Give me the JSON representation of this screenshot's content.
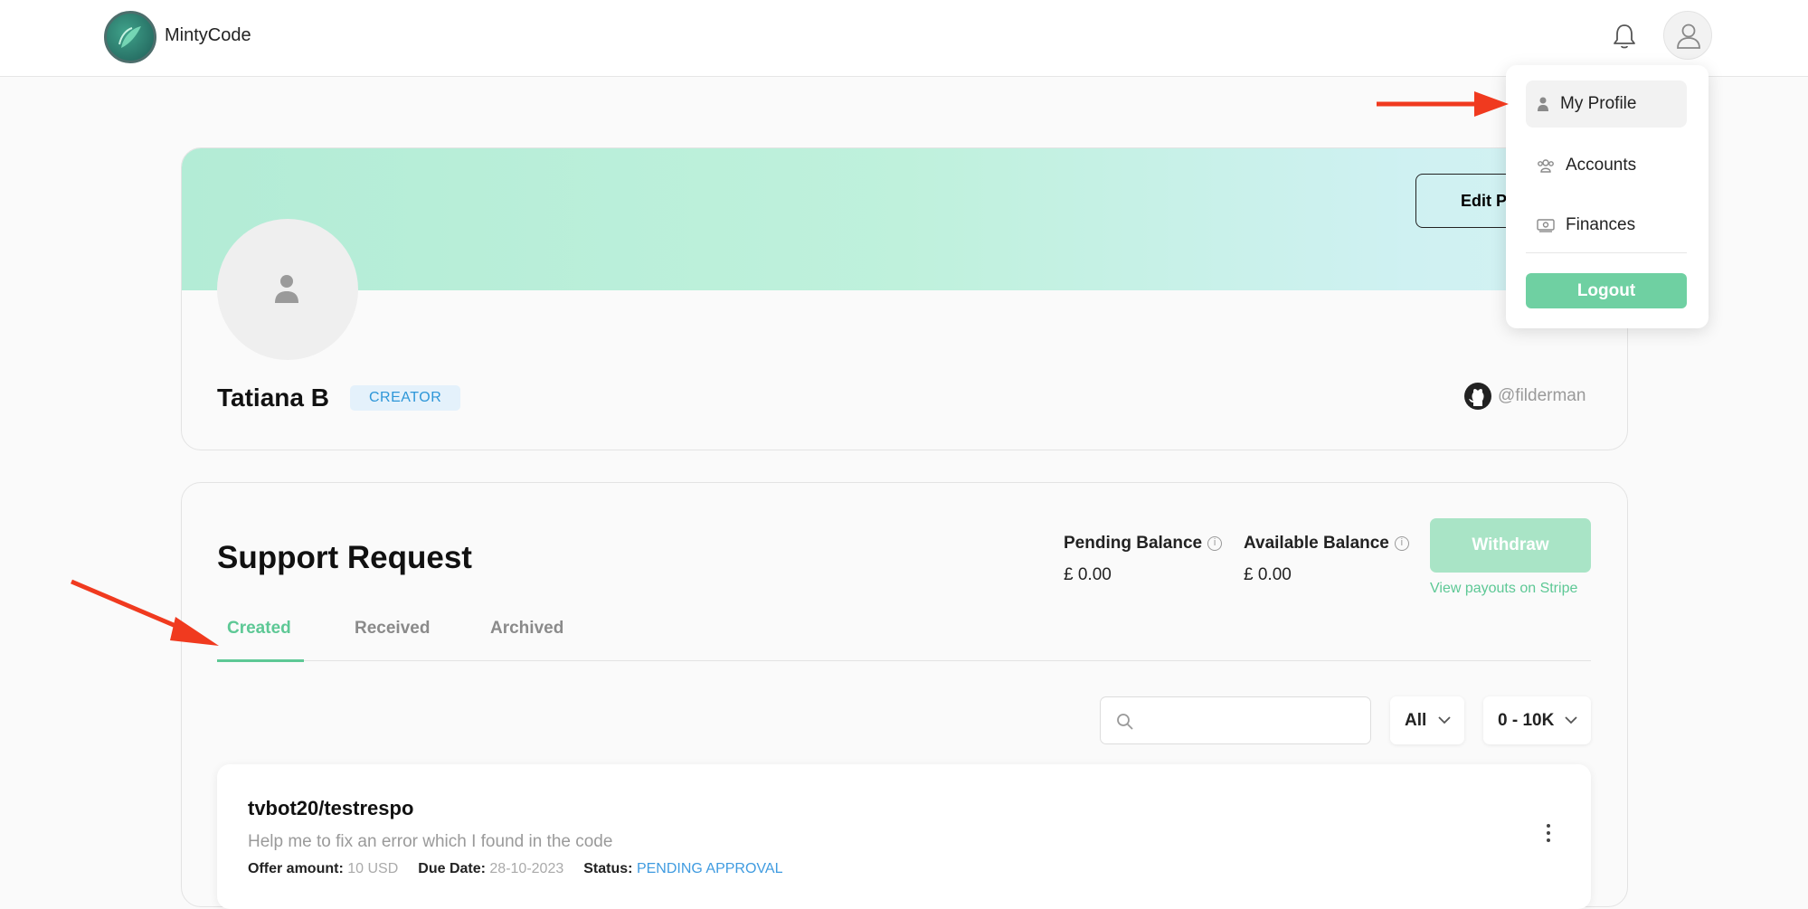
{
  "app": {
    "brand": "MintyCode"
  },
  "profile": {
    "edit_label": "Edit Pr",
    "name": "Tatiana B",
    "role_badge": "CREATOR",
    "github_handle": "@filderman"
  },
  "support": {
    "title": "Support Request",
    "pending_label": "Pending Balance",
    "pending_value": "£ 0.00",
    "available_label": "Available Balance",
    "available_value": "£ 0.00",
    "withdraw_label": "Withdraw",
    "stripe_link": "View payouts on Stripe",
    "tabs": [
      {
        "label": "Created",
        "active": true
      },
      {
        "label": "Received",
        "active": false
      },
      {
        "label": "Archived",
        "active": false
      }
    ],
    "search_placeholder": "",
    "filter_status": "All",
    "filter_amount": "0 - 10K"
  },
  "request": {
    "title": "tvbot20/testrespo",
    "description": "Help me to fix an error which I found in the code",
    "offer_label": "Offer amount:",
    "offer_value": "10 USD",
    "due_label": "Due Date:",
    "due_value": "28-10-2023",
    "status_label": "Status:",
    "status_value": "PENDING APPROVAL"
  },
  "menu": {
    "items": [
      {
        "label": "My Profile",
        "icon": "person-icon"
      },
      {
        "label": "Accounts",
        "icon": "accounts-icon"
      },
      {
        "label": "Finances",
        "icon": "finances-icon"
      }
    ],
    "logout_label": "Logout"
  },
  "colors": {
    "accent": "#5dc895",
    "logout": "#6fd0a2",
    "withdraw_disabled": "#a9e4c6",
    "badge_text": "#2d96d8",
    "status_text": "#3f9be0",
    "annotation_arrow": "#f03a1f"
  }
}
